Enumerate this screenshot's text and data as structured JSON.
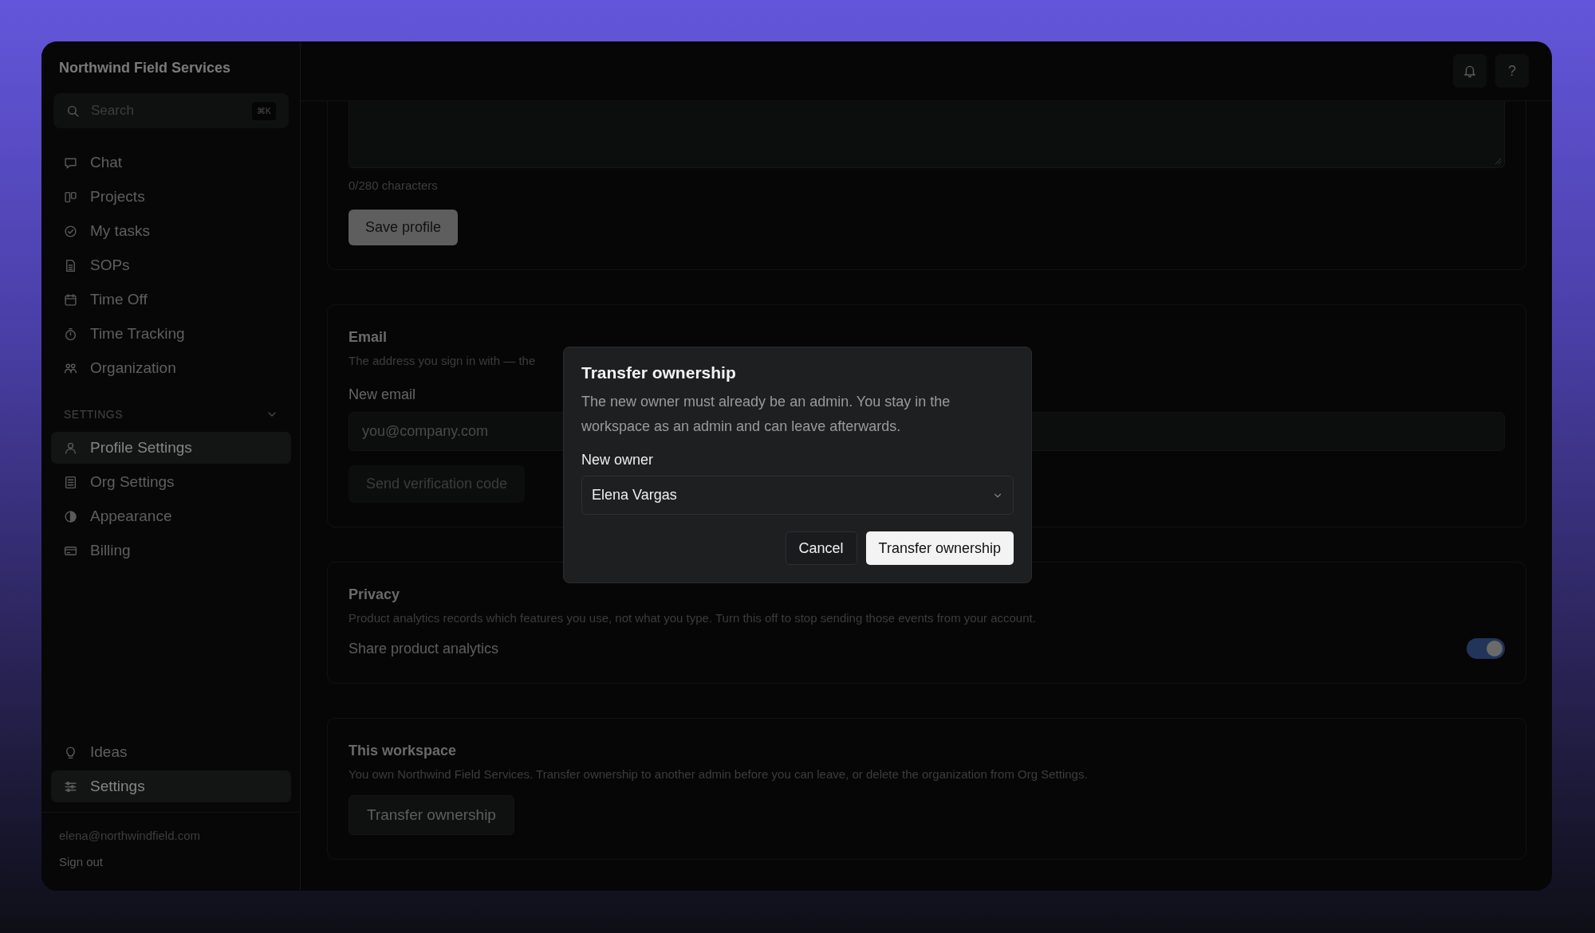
{
  "workspace": {
    "name": "Northwind Field Services"
  },
  "search": {
    "placeholder": "Search",
    "shortcut": "⌘K"
  },
  "nav": [
    {
      "label": "Chat",
      "kind": "chat",
      "selected": false
    },
    {
      "label": "Projects",
      "kind": "board",
      "selected": false
    },
    {
      "label": "My tasks",
      "kind": "check",
      "selected": false
    },
    {
      "label": "SOPs",
      "kind": "doc",
      "selected": false
    },
    {
      "label": "Time Off",
      "kind": "calendar",
      "selected": false
    },
    {
      "label": "Time Tracking",
      "kind": "stopwatch",
      "selected": false
    },
    {
      "label": "Organization",
      "kind": "people",
      "selected": false
    }
  ],
  "settings_section": {
    "label": "SETTINGS",
    "expanded": true,
    "items": [
      {
        "label": "Profile Settings",
        "kind": "person",
        "selected": true
      },
      {
        "label": "Org Settings",
        "kind": "list",
        "selected": false
      },
      {
        "label": "Appearance",
        "kind": "contrast",
        "selected": false
      },
      {
        "label": "Billing",
        "kind": "card",
        "selected": false
      }
    ]
  },
  "bottom_nav": [
    {
      "label": "Ideas",
      "kind": "bulb",
      "selected": false
    },
    {
      "label": "Settings",
      "kind": "sliders",
      "selected": true
    }
  ],
  "account": {
    "email": "elena@northwindfield.com",
    "sign_out": "Sign out"
  },
  "topbar": {
    "buttons": [
      {
        "kind": "bell"
      },
      {
        "kind": "text",
        "label": "?"
      }
    ]
  },
  "profile_card": {
    "counter": "0/280 characters",
    "save_button": "Save profile"
  },
  "email_card": {
    "title": "Email",
    "description": "The address you sign in with — the",
    "field_label": "New email",
    "placeholder": "you@company.com",
    "send_button": "Send verification code",
    "send_disabled": true
  },
  "privacy_card": {
    "title": "Privacy",
    "description": "Product analytics records which features you use, not what you type. Turn this off to stop sending those events from your account.",
    "toggle_label": "Share product analytics",
    "on": true
  },
  "workspace_card": {
    "title": "This workspace",
    "description": "You own Northwind Field Services. Transfer ownership to another admin before you can leave, or delete the organization from Org Settings.",
    "button": "Transfer ownership"
  },
  "dialog": {
    "title": "Transfer ownership",
    "body": "The new owner must already be an admin. You stay in the workspace as an admin and can leave afterwards.",
    "field_label": "New owner",
    "value": "Elena Vargas",
    "buttons": [
      {
        "label": "Cancel",
        "kind": "secondary"
      },
      {
        "label": "Transfer ownership",
        "kind": "primary"
      }
    ]
  }
}
